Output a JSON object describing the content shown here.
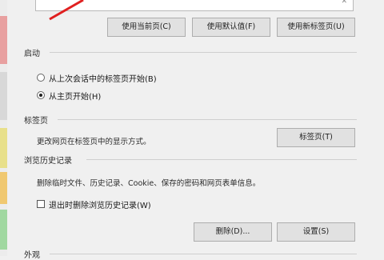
{
  "homepage": {
    "value": "",
    "scroll_glyph": "✕"
  },
  "homepage_buttons": {
    "use_current": "使用当前页(C)",
    "use_default": "使用默认值(F)",
    "use_new_tab": "使用新标签页(U)"
  },
  "startup": {
    "heading": "启动",
    "options": [
      {
        "label": "从上次会话中的标签页开始(B)",
        "checked": false
      },
      {
        "label": "从主页开始(H)",
        "checked": true
      }
    ]
  },
  "tabs": {
    "heading": "标签页",
    "description": "更改网页在标签页中的显示方式。",
    "button": "标签页(T)"
  },
  "history": {
    "heading": "浏览历史记录",
    "description": "删除临时文件、历史记录、Cookie、保存的密码和网页表单信息。",
    "checkbox_label": "退出时删除浏览历史记录(W)",
    "checkbox_checked": false,
    "delete_button": "删除(D)...",
    "settings_button": "设置(S)"
  },
  "appearance": {
    "heading": "外观"
  },
  "colors": {
    "accent": "#e02020",
    "button_face": "#e1e1e1",
    "dialog_bg": "#f0f0f0"
  }
}
